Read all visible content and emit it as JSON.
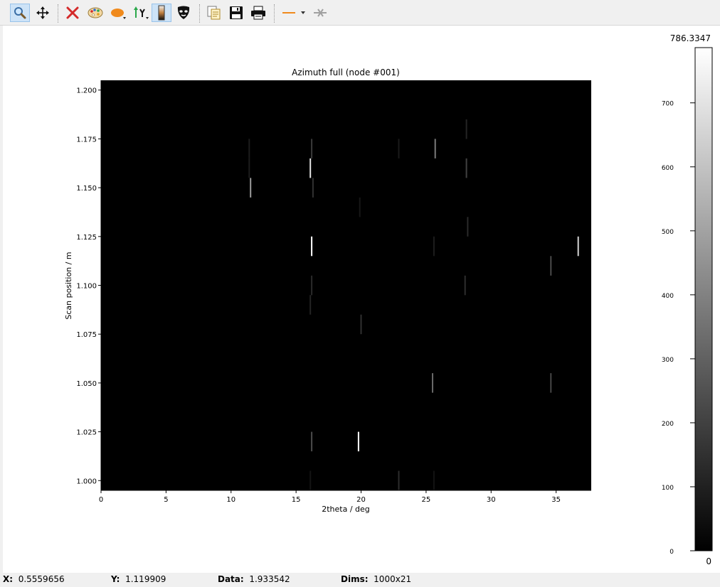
{
  "toolbar": {
    "buttons": [
      {
        "name": "zoom-mode-button",
        "icon": "magnifier-icon",
        "active": true
      },
      {
        "name": "pan-mode-button",
        "icon": "pan-arrows-icon",
        "active": false
      },
      {
        "name": "reset-zoom-button",
        "icon": "red-x-icon",
        "active": false
      },
      {
        "name": "colormap-button",
        "icon": "palette-icon",
        "active": false
      },
      {
        "name": "aspect-ratio-button",
        "icon": "ellipse-icon",
        "active": false
      },
      {
        "name": "y-axis-orientation-button",
        "icon": "y-axis-icon",
        "active": false
      },
      {
        "name": "colorbar-toggle-button",
        "icon": "colorbar-icon",
        "active": true
      },
      {
        "name": "mask-tool-button",
        "icon": "mask-icon",
        "active": false
      },
      {
        "name": "copy-button",
        "icon": "copy-icon",
        "active": false
      },
      {
        "name": "save-button",
        "icon": "floppy-icon",
        "active": false
      },
      {
        "name": "print-button",
        "icon": "printer-icon",
        "active": false
      },
      {
        "name": "profile-line-button",
        "icon": "orange-line-icon",
        "active": false
      },
      {
        "name": "clear-profile-button",
        "icon": "clear-profile-icon",
        "active": false
      }
    ]
  },
  "plot": {
    "title": "Azimuth full (node #001)",
    "xlabel": "2theta / deg",
    "ylabel": "Scan position / m"
  },
  "colorbar": {
    "max_label": "786.3347",
    "min_label": "0",
    "ticks": [
      "700",
      "600",
      "500",
      "400",
      "300",
      "200",
      "100",
      "0"
    ],
    "tick_values": [
      700,
      600,
      500,
      400,
      300,
      200,
      100,
      0
    ],
    "vmin": 0,
    "vmax": 786.3347
  },
  "status": {
    "x_label": "X:",
    "x_value": "0.5559656",
    "y_label": "Y:",
    "y_value": "1.119909",
    "data_label": "Data:",
    "data_value": "1.933542",
    "dims_label": "Dims:",
    "dims_value": "1000x21"
  },
  "chart_data": {
    "type": "heatmap",
    "title": "Azimuth full (node #001)",
    "xlabel": "2theta / deg",
    "ylabel": "Scan position / m",
    "xlim": [
      0,
      37.7
    ],
    "ylim": [
      0.995,
      1.205
    ],
    "x_ticks": [
      "0",
      "5",
      "10",
      "15",
      "20",
      "25",
      "30",
      "35"
    ],
    "x_tick_values": [
      0,
      5,
      10,
      15,
      20,
      25,
      30,
      35
    ],
    "y_ticks": [
      "1.000",
      "1.025",
      "1.050",
      "1.075",
      "1.100",
      "1.125",
      "1.150",
      "1.175",
      "1.200"
    ],
    "y_tick_values": [
      1.0,
      1.025,
      1.05,
      1.075,
      1.1,
      1.125,
      1.15,
      1.175,
      1.2
    ],
    "y_rows": [
      1.0,
      1.01,
      1.02,
      1.03,
      1.04,
      1.05,
      1.06,
      1.07,
      1.08,
      1.09,
      1.1,
      1.11,
      1.12,
      1.13,
      1.14,
      1.15,
      1.16,
      1.17,
      1.18,
      1.19,
      1.2
    ],
    "colormap": "gray",
    "vmin": 0,
    "vmax": 786.3347,
    "peaks": [
      {
        "x": 16.1,
        "y": 1.16,
        "value": 700
      },
      {
        "x": 16.2,
        "y": 1.17,
        "value": 180
      },
      {
        "x": 16.3,
        "y": 1.15,
        "value": 150
      },
      {
        "x": 11.5,
        "y": 1.15,
        "value": 480
      },
      {
        "x": 11.4,
        "y": 1.17,
        "value": 90
      },
      {
        "x": 11.4,
        "y": 1.16,
        "value": 90
      },
      {
        "x": 16.2,
        "y": 1.12,
        "value": 786
      },
      {
        "x": 16.2,
        "y": 1.1,
        "value": 130
      },
      {
        "x": 16.1,
        "y": 1.09,
        "value": 110
      },
      {
        "x": 25.7,
        "y": 1.17,
        "value": 380
      },
      {
        "x": 22.9,
        "y": 1.17,
        "value": 80
      },
      {
        "x": 28.1,
        "y": 1.18,
        "value": 110
      },
      {
        "x": 28.1,
        "y": 1.16,
        "value": 200
      },
      {
        "x": 28.2,
        "y": 1.13,
        "value": 130
      },
      {
        "x": 19.9,
        "y": 1.14,
        "value": 70
      },
      {
        "x": 25.6,
        "y": 1.12,
        "value": 90
      },
      {
        "x": 28.0,
        "y": 1.1,
        "value": 140
      },
      {
        "x": 36.7,
        "y": 1.12,
        "value": 650
      },
      {
        "x": 34.6,
        "y": 1.11,
        "value": 230
      },
      {
        "x": 20.0,
        "y": 1.08,
        "value": 150
      },
      {
        "x": 25.5,
        "y": 1.05,
        "value": 320
      },
      {
        "x": 34.6,
        "y": 1.05,
        "value": 220
      },
      {
        "x": 16.2,
        "y": 1.02,
        "value": 230
      },
      {
        "x": 19.8,
        "y": 1.02,
        "value": 786
      },
      {
        "x": 22.9,
        "y": 1.0,
        "value": 140
      },
      {
        "x": 25.6,
        "y": 1.0,
        "value": 60
      },
      {
        "x": 16.1,
        "y": 1.0,
        "value": 60
      }
    ]
  }
}
